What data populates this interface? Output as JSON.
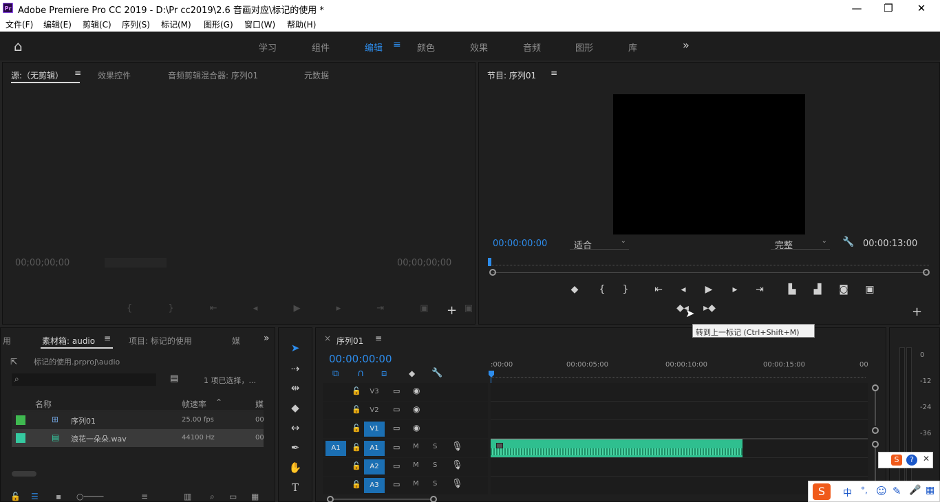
{
  "window": {
    "logo": "Pr",
    "title": "Adobe Premiere Pro CC 2019 - D:\\Pr cc2019\\2.6 音画对应\\标记的使用 *",
    "minimize": "—",
    "maximize": "❐",
    "close": "✕"
  },
  "menu": [
    "文件(F)",
    "编辑(E)",
    "剪辑(C)",
    "序列(S)",
    "标记(M)",
    "图形(G)",
    "窗口(W)",
    "帮助(H)"
  ],
  "workspaces": {
    "home": "⌂",
    "items": [
      "学习",
      "组件",
      "编辑",
      "颜色",
      "效果",
      "音频",
      "图形",
      "库"
    ],
    "active": "编辑",
    "menu_icon": "≡",
    "more": "»"
  },
  "source_panel": {
    "tabs": [
      "源:（无剪辑）",
      "效果控件",
      "音频剪辑混合器: 序列01",
      "元数据"
    ],
    "menu_icon": "≡",
    "tc_left": "00;00;00;00",
    "tc_right": "00;00;00;00",
    "add": "+"
  },
  "program_panel": {
    "title": "节目: 序列01",
    "menu_icon": "≡",
    "tc_current": "00:00:00:00",
    "fit": "适合",
    "quality": "完整",
    "tc_duration": "00:00:13:00",
    "add": "+",
    "tooltip": "转到上一标记 (Ctrl+Shift+M)"
  },
  "project_panel": {
    "tab_partial": "用",
    "tabs": [
      "素材箱: audio",
      "项目: 标记的使用",
      "媒"
    ],
    "more": "»",
    "path": "标记的使用.prproj\\audio",
    "selection": "1 项已选择，...",
    "columns": {
      "name": "名称",
      "rate": "帧速率",
      "media": "媒"
    },
    "rows": [
      {
        "color": "#3fb950",
        "name": "序列01",
        "rate": "25.00 fps",
        "media": "00"
      },
      {
        "color": "#35c9a0",
        "name": "浪花一朵朵.wav",
        "rate": "44100 Hz",
        "media": "00"
      }
    ]
  },
  "timeline": {
    "close": "×",
    "title": "序列01",
    "menu_icon": "≡",
    "timecode": "00:00:00:00",
    "ruler": [
      ":00:00",
      "00:00:05:00",
      "00:00:10:00",
      "00:00:15:00",
      "00"
    ],
    "video_tracks": [
      "V3",
      "V2",
      "V1"
    ],
    "audio_tracks": [
      "A1",
      "A2",
      "A3"
    ],
    "source_patch": "A1",
    "mute": "M",
    "solo": "S"
  },
  "meter": {
    "labels": [
      "0",
      "-12",
      "-24",
      "-36"
    ]
  },
  "ime": {
    "logo": "S",
    "items": [
      "中",
      "°,",
      "☺",
      "✎",
      "🎤",
      "▦"
    ]
  },
  "colors": {
    "accent": "#2d8ceb",
    "audio_clip": "#2fbf8f",
    "selected_track": "#1b6fb3"
  }
}
